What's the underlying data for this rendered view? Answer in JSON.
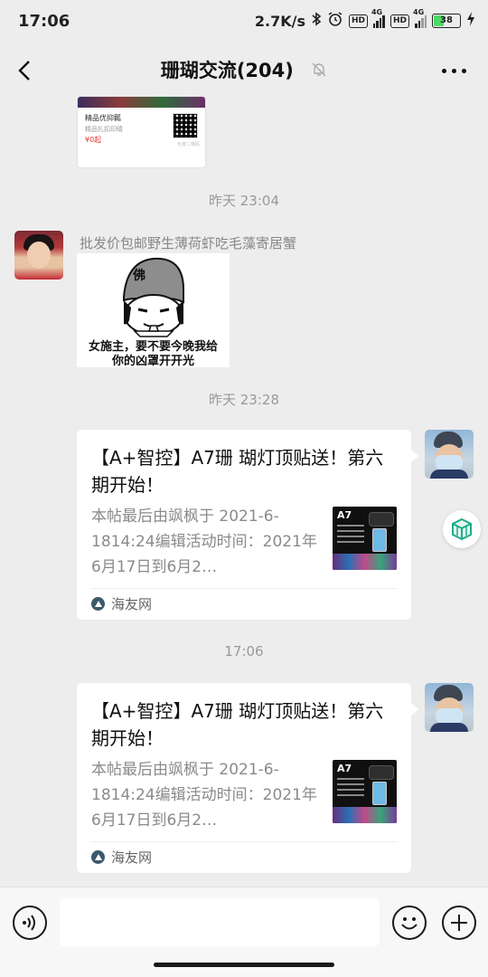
{
  "status_bar": {
    "time": "17:06",
    "net_speed": "2.7K/s",
    "hd_badge_1": "HD",
    "hd_badge_2": "HD",
    "signal_1_label": "4G",
    "signal_2_label": "4G",
    "battery": "38"
  },
  "header": {
    "title": "珊瑚交流(204)"
  },
  "previous_card": {
    "name": "精品优抑瓤",
    "sub": "精品扎扣印睛",
    "price": "¥0起",
    "note": "长按二维码"
  },
  "messages": [
    {
      "type": "timestamp",
      "text": "昨天 23:04"
    },
    {
      "type": "sticker",
      "sender": "批发价包邮野生薄荷虾吃毛藻寄居蟹",
      "sticker_text": [
        "女施主，要不要今晚我给",
        "你的凶罩开开光"
      ],
      "hat_char": "佛"
    },
    {
      "type": "timestamp",
      "text": "昨天 23:28"
    },
    {
      "type": "link_card",
      "title": "【A+智控】A7珊 瑚灯顶贴送！第六期开始！",
      "desc": "本帖最后由飒枫于 2021-6-1814:24编辑活动时间：2021年6月17日到6月2…",
      "thumb_label": "A7",
      "source": "海友网"
    },
    {
      "type": "timestamp",
      "text": "17:06"
    },
    {
      "type": "link_card",
      "title": "【A+智控】A7珊 瑚灯顶贴送！第六期开始！",
      "desc": "本帖最后由飒枫于 2021-6-1814:24编辑活动时间：2021年6月17日到6月2…",
      "thumb_label": "A7",
      "source": "海友网"
    }
  ],
  "input_bar": {
    "text": "",
    "icons": [
      "voice-icon",
      "emoji-icon",
      "plus-icon"
    ]
  },
  "colors": {
    "background": "#ededed",
    "bubble": "#ffffff",
    "timestamp": "#999999"
  }
}
